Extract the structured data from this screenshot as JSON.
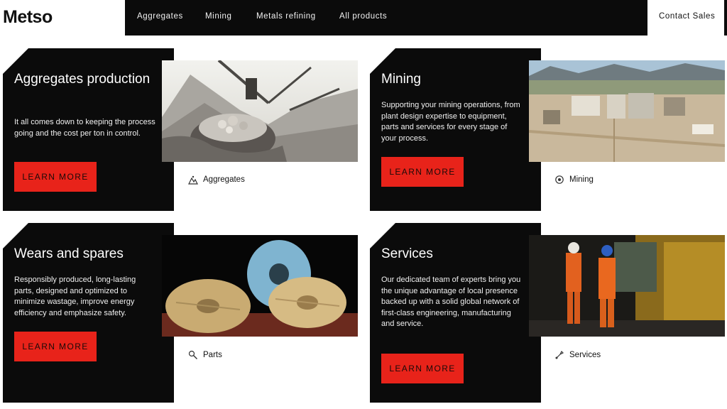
{
  "header": {
    "logo": "Metso",
    "nav": [
      "Aggregates",
      "Mining",
      "Metals refining",
      "All products"
    ],
    "contact": "Contact Sales"
  },
  "cards": [
    {
      "title": "Aggregates production",
      "description": "It all comes down to keeping the process going and the cost per ton in control.",
      "cta": "LEARN MORE",
      "tag": "Aggregates",
      "tag_icon": "aggregates-icon"
    },
    {
      "title": "Mining",
      "description": "Supporting your mining operations, from plant design expertise to equipment, parts and services for every stage of your process.",
      "cta": "LEARN MORE",
      "tag": "Mining",
      "tag_icon": "mining-icon"
    },
    {
      "title": "Wears and spares",
      "description": "Responsibly produced, long-lasting parts, designed and optimized to minimize wastage, improve energy efficiency and emphasize safety.",
      "cta": "LEARN MORE",
      "tag": "Parts",
      "tag_icon": "parts-icon"
    },
    {
      "title": "Services",
      "description": "Our dedicated team of experts bring you the unique advantage of local presence backed up with a solid global network of first-class engineering, manufacturing and service.",
      "cta": "LEARN MORE",
      "tag": "Services",
      "tag_icon": "services-icon"
    }
  ],
  "colors": {
    "brand_black": "#0b0b0b",
    "cta_red": "#e8231a"
  }
}
